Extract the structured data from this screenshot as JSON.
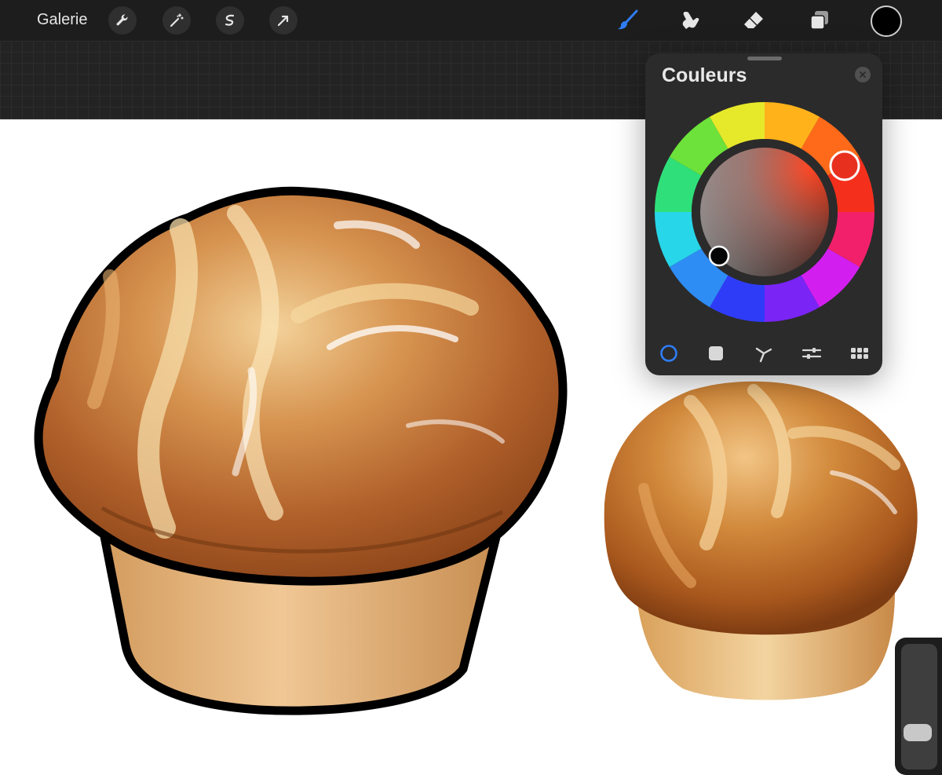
{
  "toolbar": {
    "gallery_label": "Galerie",
    "left_tools": [
      "wrench-icon",
      "magic-wand-icon",
      "selection-icon",
      "transform-arrow-icon"
    ],
    "right_tools": [
      "brush-icon",
      "smudge-icon",
      "eraser-icon",
      "layers-icon"
    ],
    "active_tool": "brush-icon",
    "accent_color": "#2f7df6",
    "current_color": "#000000"
  },
  "colors_panel": {
    "title": "Couleurs",
    "hue_handle_color": "#e8301f",
    "value_handle_color": "#050505",
    "modes": [
      "disc-mode-icon",
      "classic-mode-icon",
      "harmony-mode-icon",
      "values-mode-icon",
      "palettes-mode-icon"
    ],
    "active_mode": "disc-mode-icon"
  },
  "canvas": {
    "background": "#ffffff"
  }
}
